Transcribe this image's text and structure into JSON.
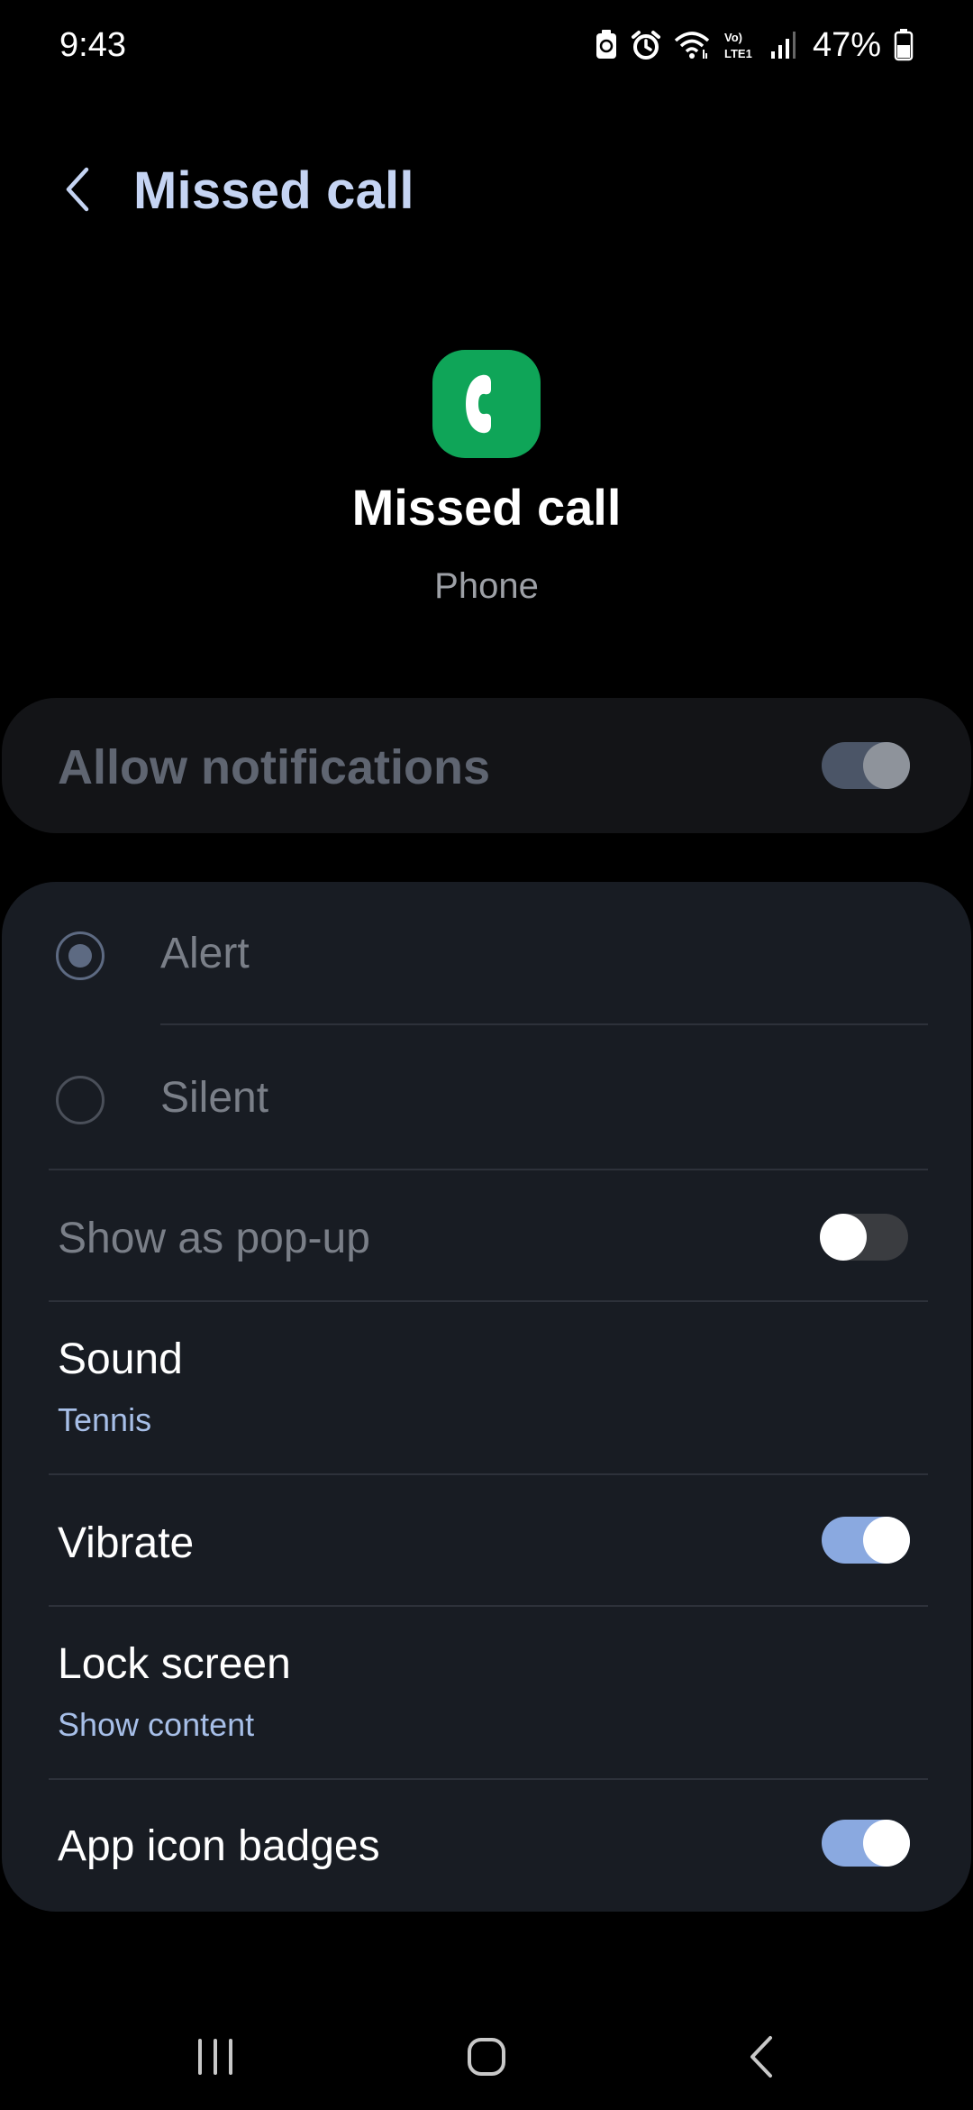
{
  "status_bar": {
    "time": "9:43",
    "battery": "47%",
    "icons": [
      "recycle-icon",
      "alarm-icon",
      "wifi-icon",
      "volte-icon",
      "signal-icon",
      "battery-icon"
    ],
    "volte_label": "Vo) LTE1"
  },
  "header": {
    "title": "Missed call",
    "back_icon": "chevron-left-icon"
  },
  "app": {
    "icon": "phone-icon",
    "name": "Missed call",
    "subtitle": "Phone",
    "icon_color": "#0fa558"
  },
  "allow_notifications": {
    "label": "Allow notifications",
    "enabled": true
  },
  "settings": {
    "alert": {
      "label": "Alert",
      "selected": true
    },
    "silent": {
      "label": "Silent",
      "selected": false
    },
    "show_popup": {
      "label": "Show as pop-up",
      "enabled": false
    },
    "sound": {
      "label": "Sound",
      "value": "Tennis"
    },
    "vibrate": {
      "label": "Vibrate",
      "enabled": true
    },
    "lock_screen": {
      "label": "Lock screen",
      "value": "Show content"
    },
    "app_icon_badges": {
      "label": "App icon badges",
      "enabled": true
    }
  },
  "colors": {
    "accent": "#8aa9e0",
    "title": "#c5d4f3",
    "subtext_accent": "#a7bfe8",
    "card_bg": "#181c23"
  },
  "nav_bar": {
    "items": [
      "recents-icon",
      "home-icon",
      "back-icon"
    ]
  }
}
